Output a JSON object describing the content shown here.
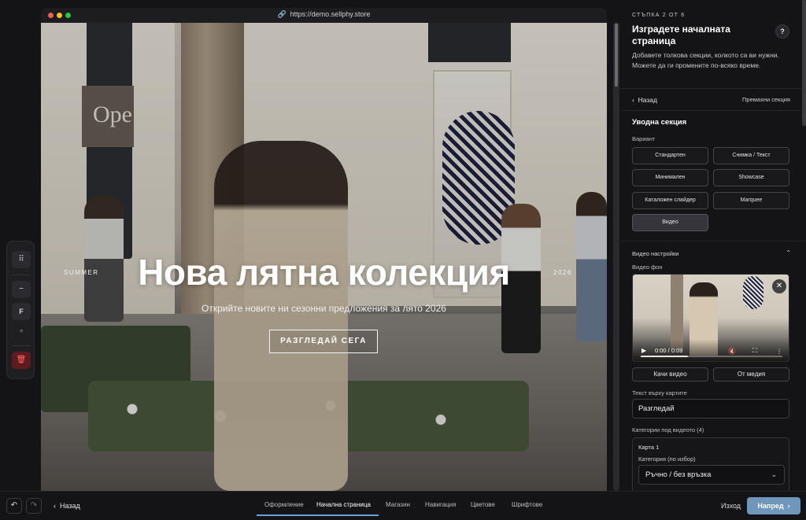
{
  "browser": {
    "url": "https://demo.sellphy.store"
  },
  "hero": {
    "left_label": "SUMMER",
    "right_label": "2026",
    "title": "Нова лятна колекция",
    "subtitle": "Открийте новите ни сезонни предложения за лято 2026",
    "cta": "РАЗГЛЕДАЙ СЕГА",
    "store_sign": "Ope"
  },
  "tools": {
    "drag": "⠿",
    "minus": "−",
    "f": "F",
    "plus": "+",
    "delete": "🗑"
  },
  "panel": {
    "step": "СТЪПКА 2 ОТ 6",
    "title": "Изградете началната страница",
    "help": "?",
    "description": "Добавете толкова секции, колкото са ви нужни. Можете да ги промените по-всяко време.",
    "back": "Назад",
    "remove": "Премахни секция",
    "section_title": "Уводна секция",
    "variant_label": "Вариант",
    "variants": [
      "Стандартен",
      "Снимка / Текст",
      "Минимален",
      "Showcase",
      "Каталожен слайдер",
      "Marquee",
      "Видео"
    ],
    "active_variant": "Видео",
    "video_settings": "Видео настройки",
    "video_bg_label": "Видео фон",
    "video_time": "0:00 / 0:09",
    "upload_video": "Качи видео",
    "from_media": "От медия",
    "button_text_label": "Текст върху картите",
    "button_text_value": "Разгледай",
    "categories_label": "Категории под видеото (4)",
    "card_title": "Карта 1",
    "card_category_label": "Категория (по избор)",
    "card_category_value": "Ръчно / без връзка"
  },
  "bottom": {
    "back": "Назад",
    "tabs": [
      "Оформление",
      "Начална страница",
      "Магазин",
      "Навигация",
      "Цветове",
      "Шрифтове"
    ],
    "active_tab": "Начална страница",
    "exit": "Изход",
    "next": "Напред"
  },
  "colors": {
    "accent": "#6aa3d8",
    "next_button": "#6f96bb",
    "delete": "#5e1a1c"
  }
}
